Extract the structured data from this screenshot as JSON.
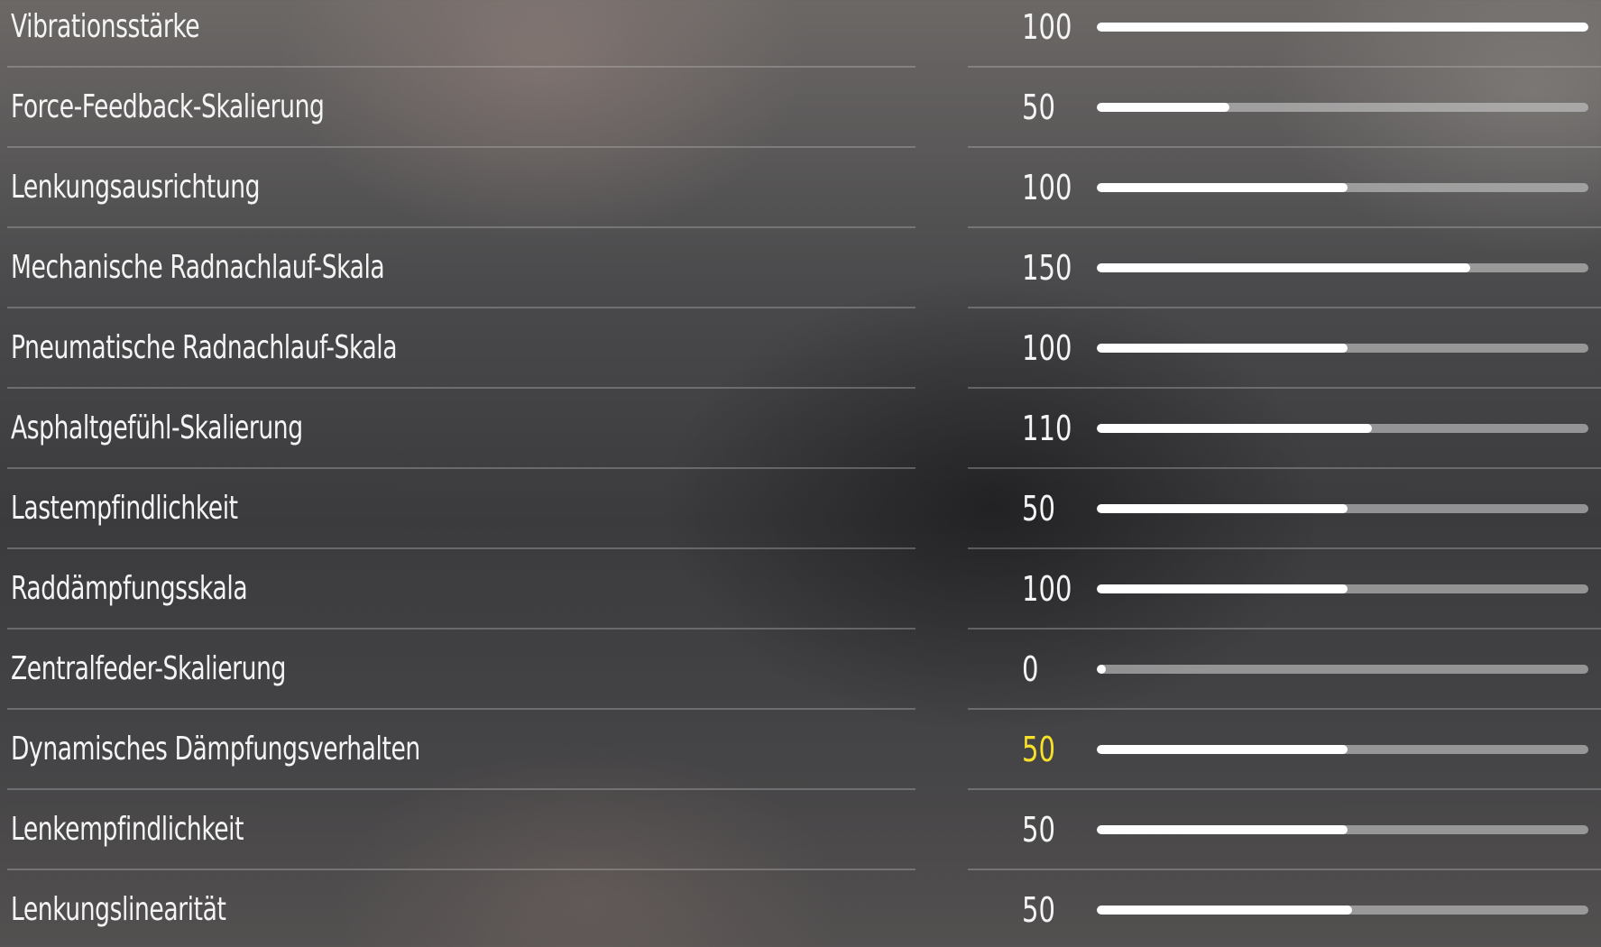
{
  "settings": [
    {
      "label": "Vibrationsstärke",
      "value": "100",
      "slider_fraction": 1.0,
      "highlighted": false
    },
    {
      "label": "Force-Feedback-Skalierung",
      "value": "50",
      "slider_fraction": 0.27,
      "highlighted": false
    },
    {
      "label": "Lenkungsausrichtung",
      "value": "100",
      "slider_fraction": 0.51,
      "highlighted": false
    },
    {
      "label": "Mechanische Radnachlauf-Skala",
      "value": "150",
      "slider_fraction": 0.76,
      "highlighted": false
    },
    {
      "label": "Pneumatische Radnachlauf-Skala",
      "value": "100",
      "slider_fraction": 0.51,
      "highlighted": false
    },
    {
      "label": "Asphaltgefühl-Skalierung",
      "value": "110",
      "slider_fraction": 0.56,
      "highlighted": false
    },
    {
      "label": "Lastempfindlichkeit",
      "value": "50",
      "slider_fraction": 0.51,
      "highlighted": false
    },
    {
      "label": "Raddämpfungsskala",
      "value": "100",
      "slider_fraction": 0.51,
      "highlighted": false
    },
    {
      "label": "Zentralfeder-Skalierung",
      "value": "0",
      "slider_fraction": 0.0,
      "highlighted": false
    },
    {
      "label": "Dynamisches Dämpfungsverhalten",
      "value": "50",
      "slider_fraction": 0.51,
      "highlighted": true
    },
    {
      "label": "Lenkempfindlichkeit",
      "value": "50",
      "slider_fraction": 0.51,
      "highlighted": false
    },
    {
      "label": "Lenkungslinearität",
      "value": "50",
      "slider_fraction": 0.52,
      "highlighted": false
    }
  ],
  "colors": {
    "text": "#f4f4f4",
    "highlight": "#f5e02a",
    "slider_fill": "#ffffff",
    "slider_track": "#c8c8c8"
  }
}
